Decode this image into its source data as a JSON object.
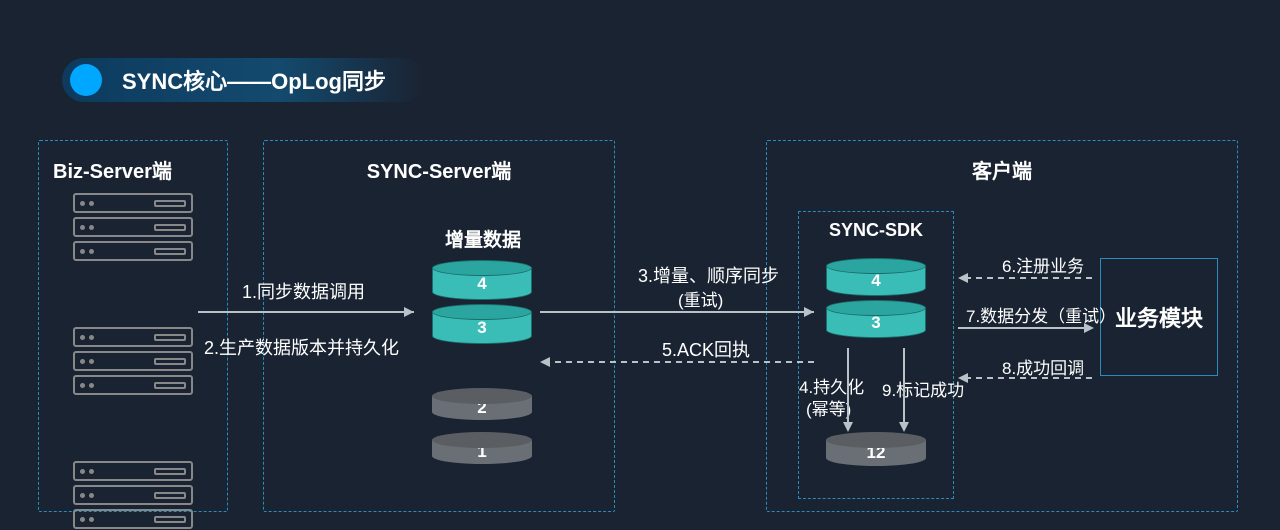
{
  "title": "SYNC核心——OpLog同步",
  "panels": {
    "biz": "Biz-Server端",
    "sync": "SYNC-Server端",
    "client": "客户端"
  },
  "inc_label": "增量数据",
  "sdk_title": "SYNC-SDK",
  "biz_module": "业务模块",
  "sync_cylinders": {
    "active": [
      "4",
      "3"
    ],
    "gray": [
      "2",
      "1"
    ]
  },
  "sdk_cylinders": {
    "active": [
      "4",
      "3"
    ],
    "result": "12"
  },
  "steps": {
    "s1": "1.同步数据调用",
    "s2": "2.生产数据版本并持久化",
    "s3a": "3.增量、顺序同步",
    "s3b": "(重试)",
    "s4a": "4.持久化",
    "s4b": "(幂等)",
    "s5": "5.ACK回执",
    "s6": "6.注册业务",
    "s7": "7.数据分发（重试）",
    "s8": "8.成功回调",
    "s9": "9.标记成功"
  }
}
